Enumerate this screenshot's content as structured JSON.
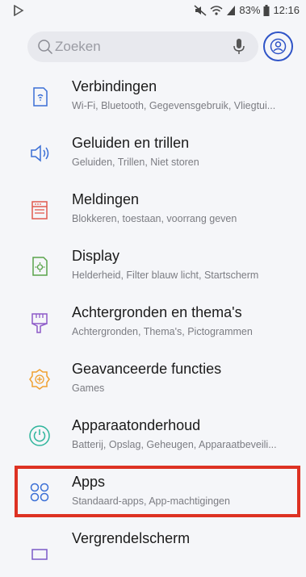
{
  "status_bar": {
    "battery": "83%",
    "time": "12:16",
    "icons": [
      "notification-icon",
      "mute-icon",
      "wifi-icon",
      "signal-icon",
      "battery-icon"
    ]
  },
  "search": {
    "placeholder": "Zoeken",
    "mic_icon": "mic-icon",
    "account_icon": "account-icon"
  },
  "settings": {
    "items": [
      {
        "title": "Verbindingen",
        "subtitle": "Wi-Fi, Bluetooth, Gegevensgebruik, Vliegtui...",
        "icon": "connections-icon",
        "color": "#3b6fd6"
      },
      {
        "title": "Geluiden en trillen",
        "subtitle": "Geluiden, Trillen, Niet storen",
        "icon": "sound-icon",
        "color": "#3b6fd6"
      },
      {
        "title": "Meldingen",
        "subtitle": "Blokkeren, toestaan, voorrang geven",
        "icon": "notifications-icon",
        "color": "#e05a4f"
      },
      {
        "title": "Display",
        "subtitle": "Helderheid, Filter blauw licht, Startscherm",
        "icon": "display-icon",
        "color": "#5aa34a"
      },
      {
        "title": "Achtergronden en thema's",
        "subtitle": "Achtergronden, Thema's, Pictogrammen",
        "icon": "wallpaper-icon",
        "color": "#8d5ac8"
      },
      {
        "title": "Geavanceerde functies",
        "subtitle": "Games",
        "icon": "advanced-features-icon",
        "color": "#f0a030"
      },
      {
        "title": "Apparaatonderhoud",
        "subtitle": "Batterij, Opslag, Geheugen, Apparaatbeveili...",
        "icon": "device-care-icon",
        "color": "#2fb59c"
      },
      {
        "title": "Apps",
        "subtitle": "Standaard-apps, App-machtigingen",
        "icon": "apps-icon",
        "color": "#3b6fd6"
      },
      {
        "title": "Vergrendelscherm",
        "subtitle": "",
        "icon": "lockscreen-icon",
        "color": "#7b5ac8"
      }
    ]
  },
  "highlight": {
    "color": "#dd3223",
    "target": "Apps"
  }
}
